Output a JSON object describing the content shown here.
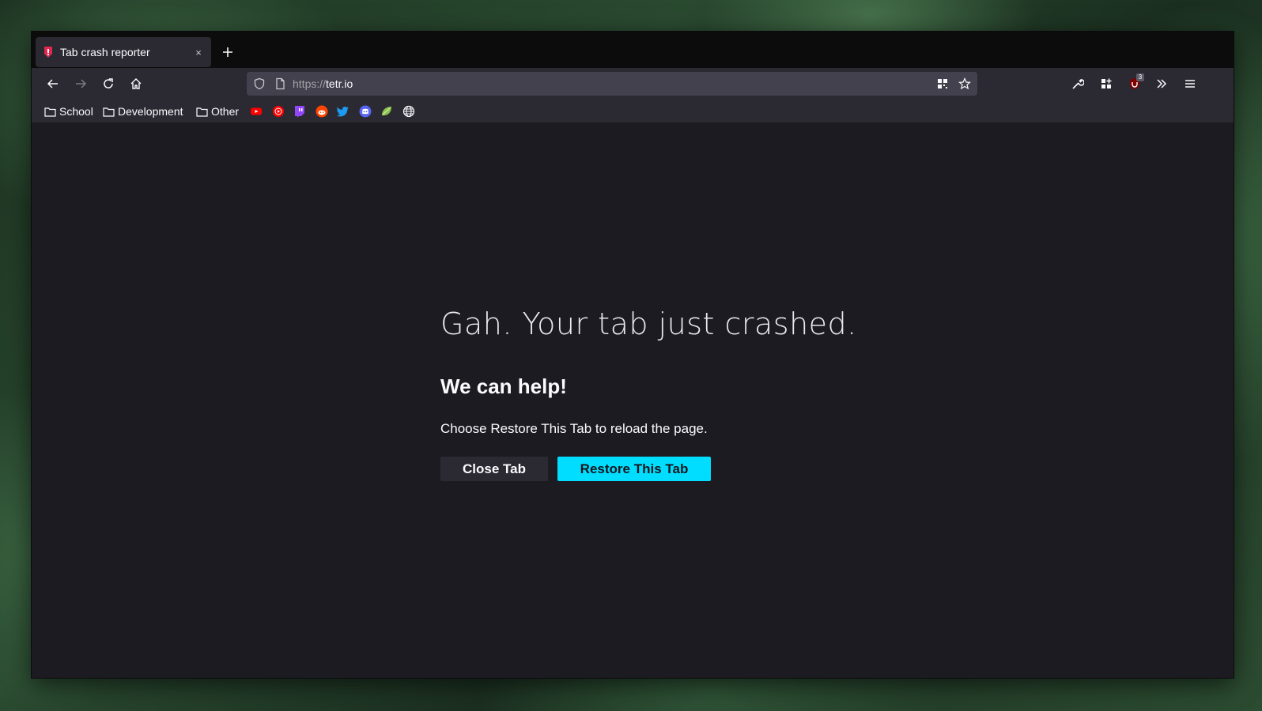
{
  "tab": {
    "title": "Tab crash reporter",
    "close_symbol": "×"
  },
  "new_tab_symbol": "+",
  "urlbar": {
    "scheme": "https://",
    "host": "tetr.io"
  },
  "toolbar": {
    "extension_badge": "3"
  },
  "bookmarks": {
    "folders": [
      {
        "label": "School"
      },
      {
        "label": "Development"
      },
      {
        "label": "Other"
      }
    ],
    "sites": [
      "youtube-icon",
      "youtube-music-icon",
      "twitch-icon",
      "reddit-icon",
      "twitter-icon",
      "discord-icon",
      "lime-icon",
      "globe-icon"
    ]
  },
  "crash_page": {
    "title": "Gah. Your tab just crashed.",
    "heading": "We can help!",
    "message": "Choose Restore This Tab to reload the page.",
    "close_button": "Close Tab",
    "restore_button": "Restore This Tab"
  },
  "colors": {
    "accent": "#00ddff",
    "page_background": "#1c1b22",
    "toolbar": "#2b2a33",
    "urlbar": "#42414d"
  }
}
